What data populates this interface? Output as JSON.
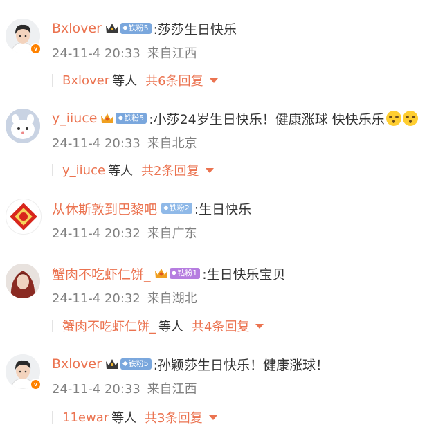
{
  "comments": [
    {
      "user": "Bxlover",
      "fan_level": "铁粉5",
      "fan_color": "#7aa7dd",
      "text": ":莎莎生日快乐",
      "time": "24-11-4 20:33",
      "location": "来自江西",
      "reply_user": "Bxlover",
      "reply_etc": "等人",
      "reply_count": "共6条回复",
      "avatar": "boy-avatar"
    },
    {
      "user": "y_iiuce",
      "fan_level": "铁粉5",
      "fan_color": "#7aa7dd",
      "text": ":小莎24岁生日快乐！健康涨球 快快乐乐",
      "time": "24-11-4 20:33",
      "location": "来自北京",
      "reply_user": "y_iiuce",
      "reply_etc": "等人",
      "reply_count": "共2条回复",
      "avatar": "cartoon-avatar"
    },
    {
      "user": "从休斯敦到巴黎吧",
      "fan_level": "铁粉2",
      "fan_color": "#8fb9e8",
      "text": ":生日快乐",
      "time": "24-11-4 20:32",
      "location": "来自广东",
      "avatar": "red-seal-avatar"
    },
    {
      "user": "蟹肉不吃虾仁饼_",
      "fan_level": "钻粉1",
      "fan_color": "#b67de0",
      "text": ":生日快乐宝贝",
      "time": "24-11-4 20:32",
      "location": "来自湖北",
      "reply_user": "蟹肉不吃虾仁饼_",
      "reply_etc": "等人",
      "reply_count": "共4条回复",
      "avatar": "redhair-avatar"
    },
    {
      "user": "Bxlover",
      "fan_level": "铁粉5",
      "fan_color": "#7aa7dd",
      "text": ":孙颖莎生日快乐！健康涨球！",
      "time": "24-11-4 20:33",
      "location": "来自江西",
      "reply_user": "11ewar",
      "reply_etc": "等人",
      "reply_count": "共3条回复",
      "avatar": "boy-avatar"
    }
  ],
  "colors": {
    "name": "#eb7350",
    "meta": "#808080",
    "vip": "#ff8200"
  }
}
